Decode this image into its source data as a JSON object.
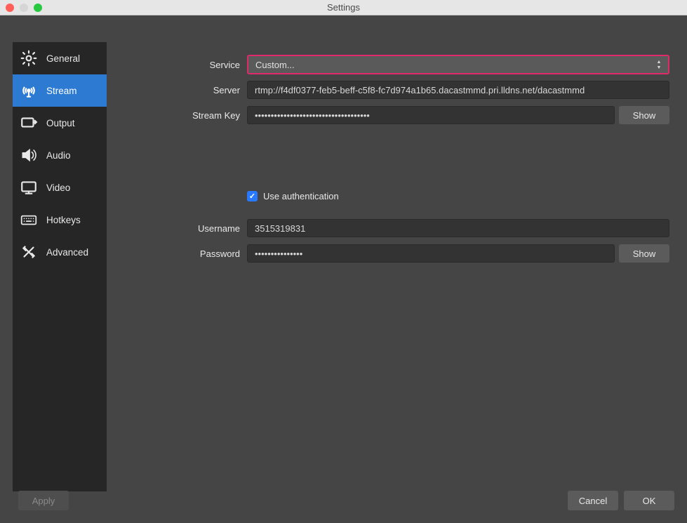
{
  "title": "Settings",
  "sidebar": {
    "items": [
      {
        "label": "General"
      },
      {
        "label": "Stream"
      },
      {
        "label": "Output"
      },
      {
        "label": "Audio"
      },
      {
        "label": "Video"
      },
      {
        "label": "Hotkeys"
      },
      {
        "label": "Advanced"
      }
    ],
    "active_index": 1
  },
  "form": {
    "service": {
      "label": "Service",
      "value": "Custom..."
    },
    "server": {
      "label": "Server",
      "value": "rtmp://f4df0377-feb5-beff-c5f8-fc7d974a1b65.dacastmmd.pri.lldns.net/dacastmmd"
    },
    "stream_key": {
      "label": "Stream Key",
      "value": "••••••••••••••••••••••••••••••••••••",
      "show_label": "Show"
    },
    "use_auth": {
      "label": "Use authentication",
      "checked": true
    },
    "username": {
      "label": "Username",
      "value": "3515319831"
    },
    "password": {
      "label": "Password",
      "value": "•••••••••••••••",
      "show_label": "Show"
    }
  },
  "footer": {
    "apply": "Apply",
    "cancel": "Cancel",
    "ok": "OK"
  },
  "colors": {
    "highlight_border": "#e0296b",
    "active_sidebar": "#2c7ad1",
    "checkbox": "#2879ff"
  }
}
